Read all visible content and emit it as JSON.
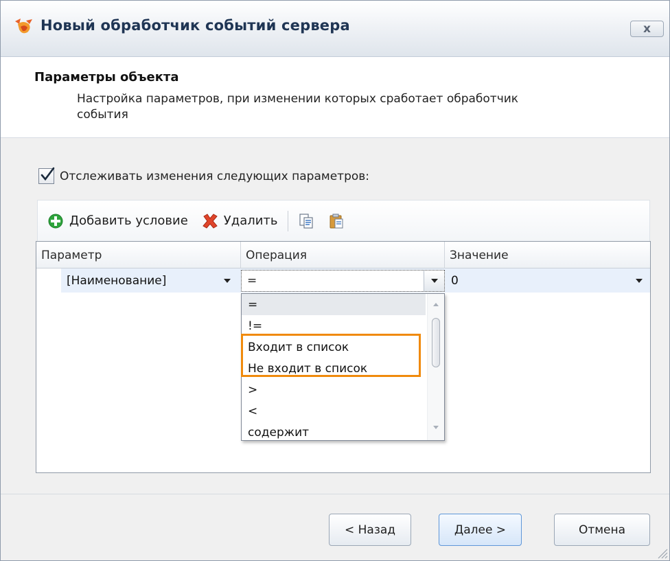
{
  "window": {
    "title": "Новый обработчик событий сервера",
    "close_label": "x"
  },
  "header": {
    "title": "Параметры объекта",
    "subtitle": "Настройка параметров, при изменении которых сработает обработчик события"
  },
  "track_changes": {
    "label": "Отслеживать изменения следующих параметров:",
    "checked": true
  },
  "toolbar": {
    "add_label": "Добавить условие",
    "delete_label": "Удалить",
    "copy_icon": "copy-icon",
    "paste_icon": "paste-icon"
  },
  "grid": {
    "columns": [
      "Параметр",
      "Операция",
      "Значение"
    ],
    "row": {
      "parameter": "[Наименование]",
      "operation": "=",
      "value": "0"
    }
  },
  "operation_dropdown": {
    "options": [
      "=",
      "!=",
      "Входит в список",
      "Не входит в список",
      ">",
      "<",
      "содержит"
    ],
    "selected": "=",
    "highlighted": [
      "Входит в список",
      "Не входит в список"
    ],
    "highlight_color": "#f08a0c"
  },
  "footer": {
    "back_label": "< Назад",
    "next_label": "Далее >",
    "cancel_label": "Отмена"
  },
  "colors": {
    "title_text": "#1f3554",
    "row_selected": "#e8f0fb",
    "add_icon_green": "#2ea43c",
    "delete_icon_red": "#e0452b"
  }
}
